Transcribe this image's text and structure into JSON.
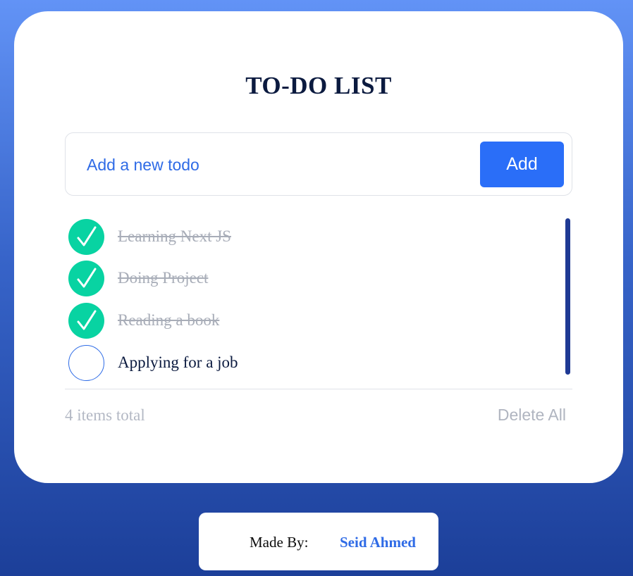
{
  "app": {
    "title": "TO-DO LIST"
  },
  "input": {
    "placeholder": "Add a new todo",
    "value": ""
  },
  "add_button": {
    "label": "Add"
  },
  "todos": [
    {
      "text": "Learning Next JS",
      "done": true
    },
    {
      "text": "Doing Project",
      "done": true
    },
    {
      "text": "Reading a book",
      "done": true
    },
    {
      "text": "Applying for a job",
      "done": false
    }
  ],
  "footer_bar": {
    "count_label": "4 items total",
    "delete_all_label": "Delete All"
  },
  "credit": {
    "made_by_label": "Made By:",
    "author": "Seid Ahmed"
  },
  "icons": {
    "checked": "checkmark-icon",
    "unchecked": "empty-circle-icon"
  },
  "colors": {
    "accent": "#2a6ef8",
    "done_check": "#08d3a2",
    "done_text": "#a8adb8",
    "title": "#0b1a3f",
    "scrollbar": "#1f3a94"
  }
}
